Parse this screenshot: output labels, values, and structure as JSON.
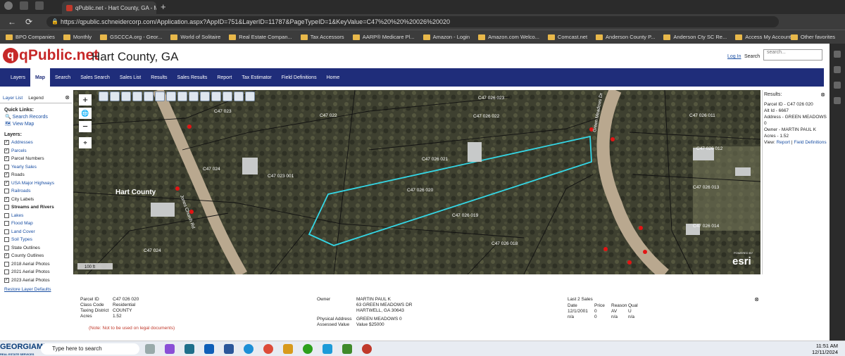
{
  "browser": {
    "tab_title": "qPublic.net - Hart County, GA - M",
    "url": "https://qpublic.schneidercorp.com/Application.aspx?AppID=751&LayerID=11787&PageTypeID=1&KeyValue=C47%20%20%20026%20020",
    "bookmarks": [
      "BPO Companies",
      "Monthly",
      "GSCCCA.org - Geor...",
      "World of Solitaire",
      "Real Estate Compan...",
      "Tax Accessors",
      "AARP® Medicare Pl...",
      "Amazon - Login",
      "Amazon.com Welco...",
      "Comcast.net",
      "Anderson County P...",
      "Anderson Cty SC Re...",
      "Access My Account..."
    ],
    "other_favorites": "Other favorites"
  },
  "header": {
    "brand": "qPublic.net",
    "county": "Hart County, GA",
    "login": "Log In",
    "search": "Search",
    "search_placeholder": "search..."
  },
  "menu": {
    "items": [
      "Layers",
      "Map",
      "Search",
      "Sales Search",
      "Sales List",
      "Results",
      "Sales Results",
      "Report",
      "Tax Estimator",
      "Field Definitions",
      "Home"
    ],
    "active": "Map"
  },
  "left_panel": {
    "tabs": [
      "Layer List",
      "Legend"
    ],
    "quick_links_title": "Quick Links:",
    "quick_links": [
      "Search Records",
      "View Map"
    ],
    "layers_title": "Layers:",
    "layers": [
      {
        "label": "Addresses",
        "checked": true,
        "style": "link"
      },
      {
        "label": "Parcels",
        "checked": true,
        "style": "link"
      },
      {
        "label": "Parcel Numbers",
        "checked": true,
        "style": "plain"
      },
      {
        "label": "Yearly Sales",
        "checked": false,
        "style": "link"
      },
      {
        "label": "Roads",
        "checked": true,
        "style": "plain"
      },
      {
        "label": "USA Major Highways",
        "checked": true,
        "style": "link"
      },
      {
        "label": "Railroads",
        "checked": false,
        "style": "link"
      },
      {
        "label": "City Labels",
        "checked": true,
        "style": "plain"
      },
      {
        "label": "Streams and Rivers",
        "checked": false,
        "style": "bold"
      },
      {
        "label": "Lakes",
        "checked": false,
        "style": "link"
      },
      {
        "label": "Flood Map",
        "checked": false,
        "style": "link"
      },
      {
        "label": "Land Cover",
        "checked": false,
        "style": "link"
      },
      {
        "label": "Soil Types",
        "checked": false,
        "style": "link"
      },
      {
        "label": "State Outlines",
        "checked": false,
        "style": "plain"
      },
      {
        "label": "County Outlines",
        "checked": true,
        "style": "plain"
      },
      {
        "label": "2018 Aerial Photos",
        "checked": false,
        "style": "plain"
      },
      {
        "label": "2021 Aerial Photos",
        "checked": false,
        "style": "plain"
      },
      {
        "label": "2023 Aerial Photos",
        "checked": true,
        "style": "plain"
      }
    ],
    "restore": "Restore Layer Defaults"
  },
  "map": {
    "county_label": "Hart County",
    "parcel_labels": [
      "C47 023",
      "C47 022",
      "C47 026 023",
      "C47 026 022",
      "C47 026 021",
      "C47 024",
      "C47 023 001",
      "C47 026 020",
      "C47 026 019",
      "C47 026 018",
      "C47 024",
      "C47 026 011",
      "C47 026 012",
      "C47 026 013",
      "C47 026 014"
    ],
    "road_labels": [
      "Green Meadows Dr",
      "Jones Church Rd"
    ],
    "scale": "100 ft",
    "powered": "POWERED BY",
    "esri": "esri"
  },
  "results": {
    "title": "Results:",
    "parcel_id": "Parcel ID - C47 026 020",
    "alt_id": "Alt Id - 6667",
    "address": "Address - GREEN MEADOWS 0",
    "owner": "Owner - MARTIN PAUL K",
    "acres": "Acres - 1.52",
    "view": "View:",
    "report": "Report",
    "field_defs": "Field Definitions"
  },
  "detail": {
    "labels": [
      "Parcel ID",
      "Class Code",
      "Taxing District",
      "Acres"
    ],
    "values": [
      "C47 026 020",
      "Residential",
      "COUNTY",
      "1.52"
    ],
    "note": "(Note: Not to be used on legal documents)",
    "owner_label": "Owner",
    "owner_lines": [
      "MARTIN PAUL K",
      "63 GREEN MEADOWS DR",
      "HARTWELL, GA 30643"
    ],
    "phys_label": "Physical Address",
    "phys_value": "GREEN MEADOWS 0",
    "assessed_label": "Assessed Value",
    "assessed_value": "Value $25000",
    "sales_title": "Last 2 Sales",
    "sales_headers": [
      "Date",
      "Price",
      "Reason",
      "Qual"
    ],
    "sales_rows": [
      [
        "12/1/2001",
        "0",
        "AV",
        "U"
      ],
      [
        "n/a",
        "0",
        "n/a",
        "n/a"
      ]
    ]
  },
  "taskbar": {
    "brand": "GEORGIAMLS",
    "brand_sub": "REAL ESTATE SERVICES",
    "search": "Type here to search",
    "time": "11:51 AM",
    "date": "12/11/2024"
  }
}
